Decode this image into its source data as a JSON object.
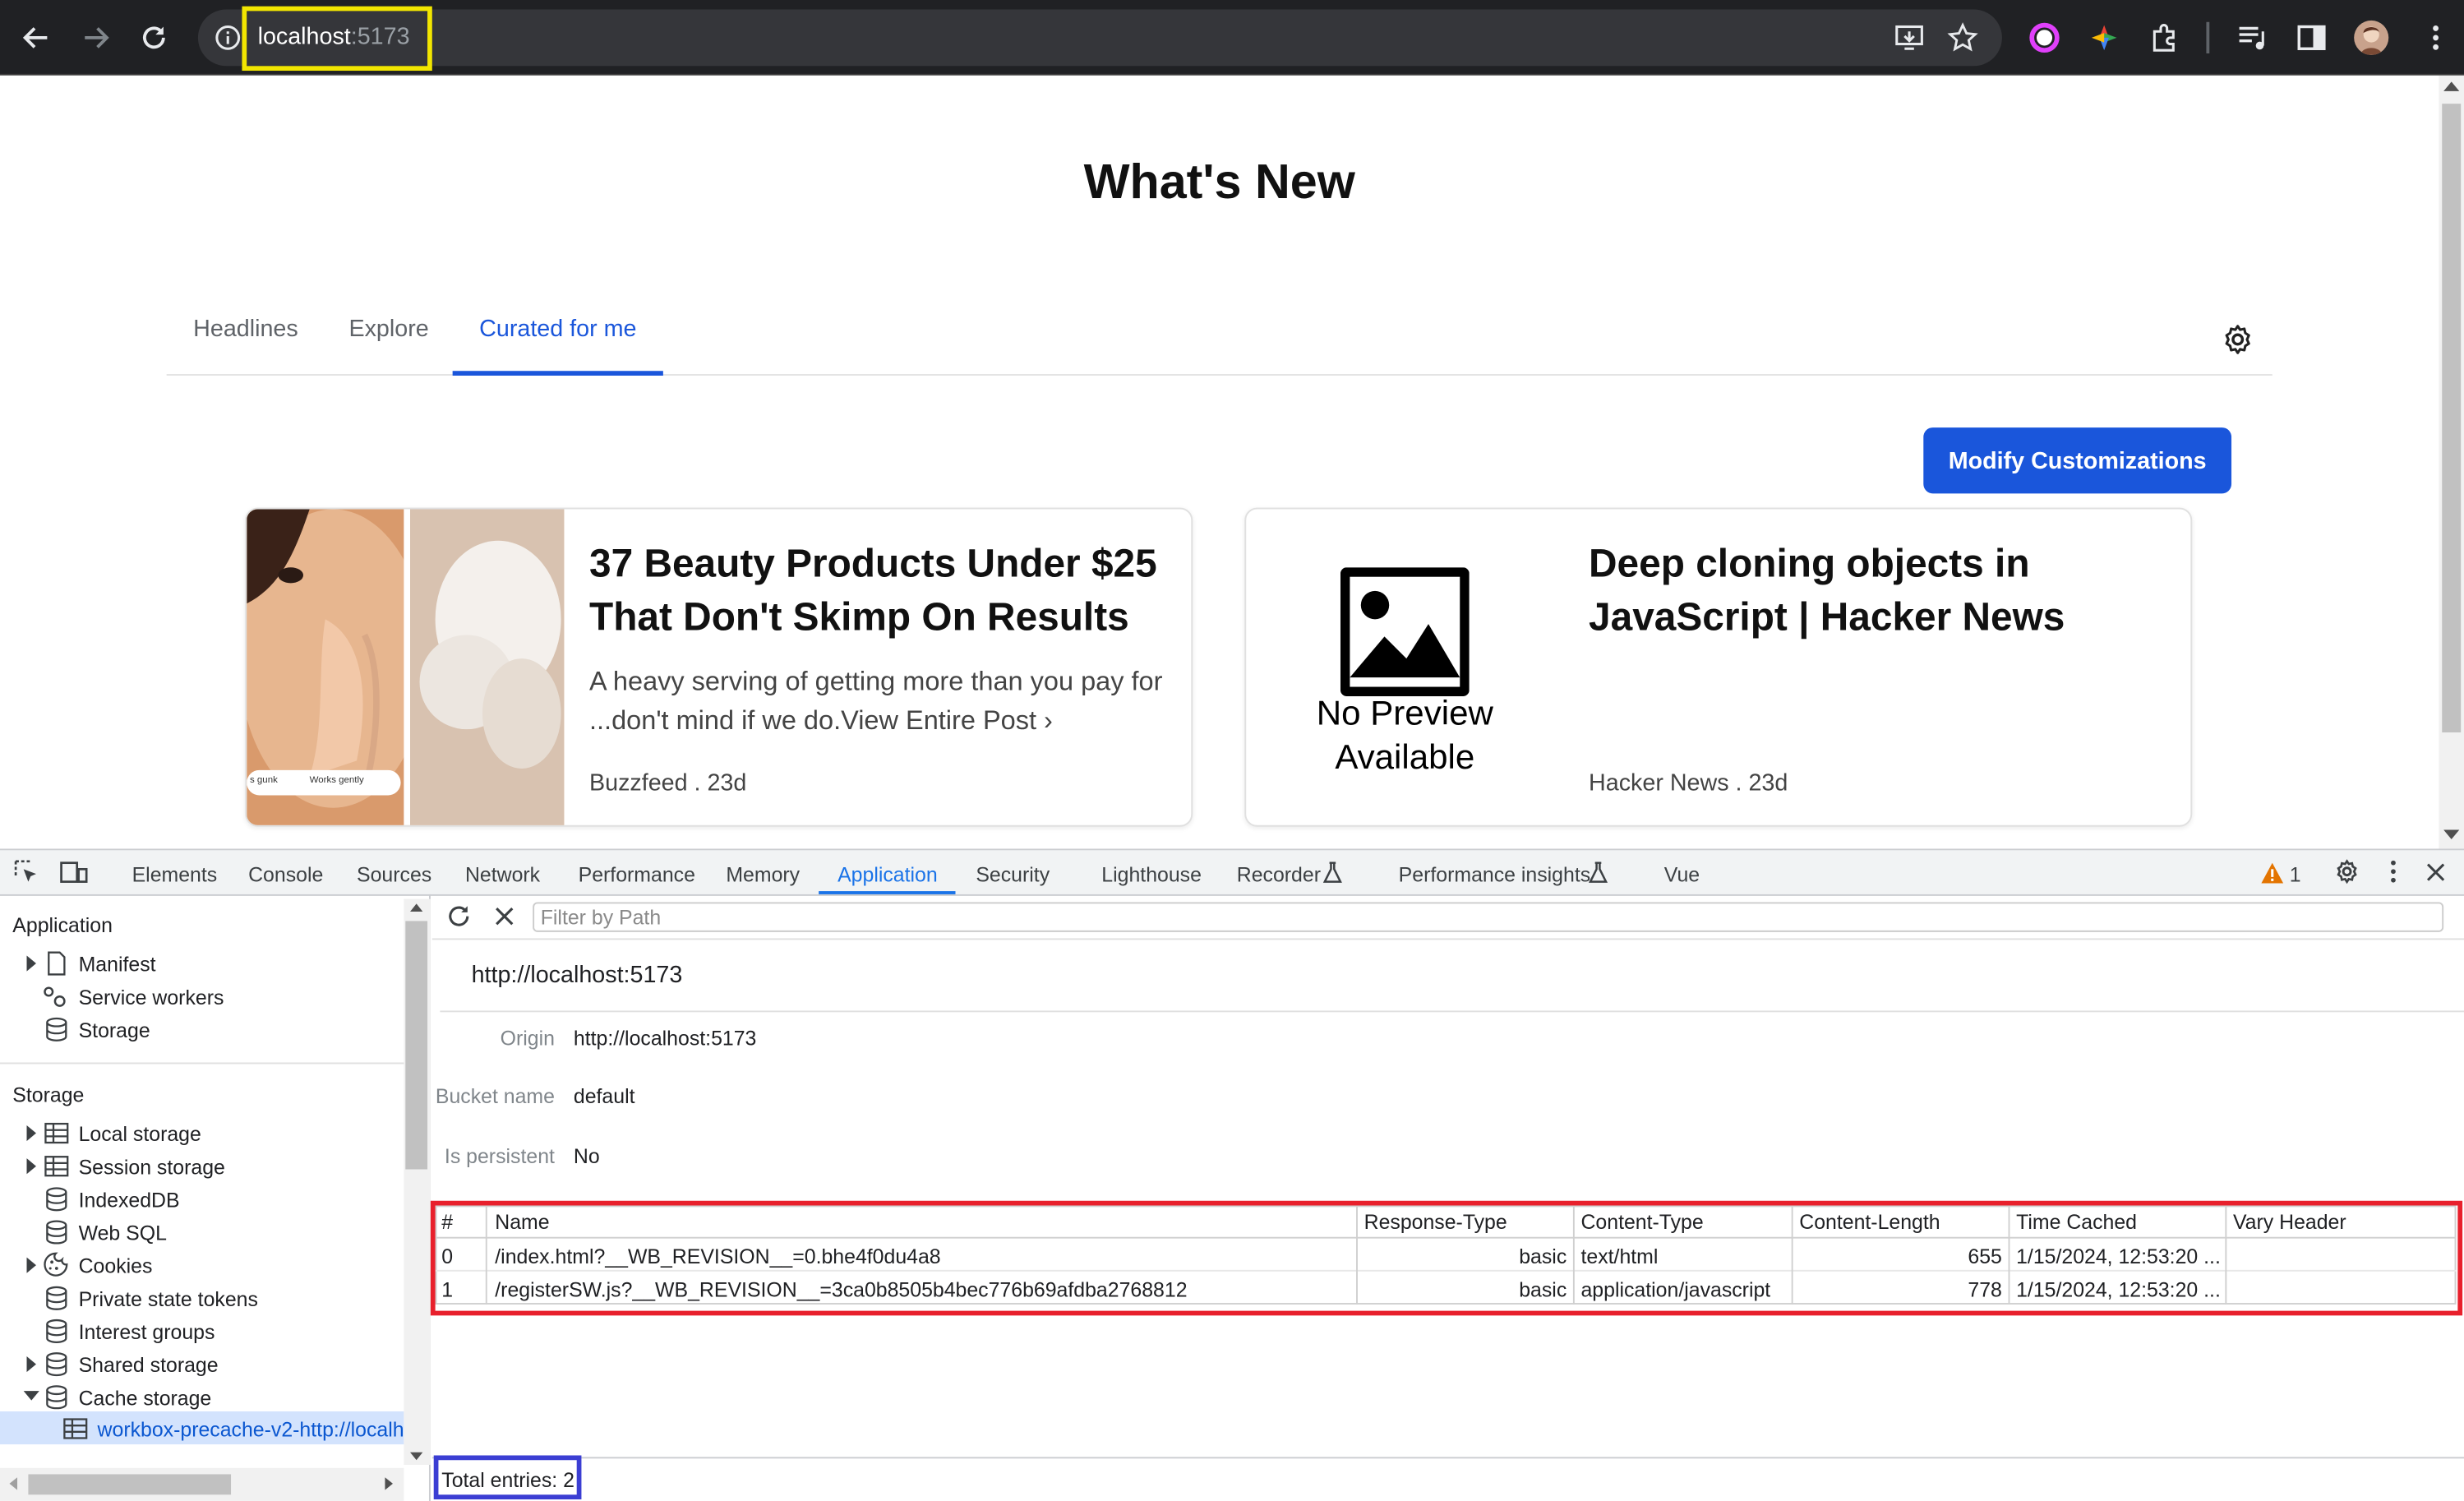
{
  "browser": {
    "url_host": "localhost",
    "url_port": ":5173"
  },
  "page": {
    "title": "What's New",
    "tabs": [
      {
        "label": "Headlines"
      },
      {
        "label": "Explore"
      },
      {
        "label": "Curated for me"
      }
    ],
    "modify_button": "Modify Customizations",
    "cards": [
      {
        "title_line1": "37 Beauty Products Under $25",
        "title_line2": "That Don't Skimp On Results",
        "desc_line1": "A heavy serving of getting more than you pay for",
        "desc_line2": "...don't mind if we do.View Entire Post ›",
        "meta": "Buzzfeed . 23d",
        "image_caption_left": "s gunk",
        "image_caption_right": "Works gently"
      },
      {
        "title_line1": "Deep cloning objects in",
        "title_line2": "JavaScript | Hacker News",
        "meta": "Hacker News . 23d",
        "no_preview_line1": "No Preview",
        "no_preview_line2": "Available"
      }
    ]
  },
  "devtools": {
    "tabs": [
      "Elements",
      "Console",
      "Sources",
      "Network",
      "Performance",
      "Memory",
      "Application",
      "Security",
      "Lighthouse",
      "Recorder",
      "Performance insights",
      "Vue"
    ],
    "warning_count": "1",
    "sidebar": {
      "application_heading": "Application",
      "application_items": [
        "Manifest",
        "Service workers",
        "Storage"
      ],
      "storage_heading": "Storage",
      "storage_items": [
        "Local storage",
        "Session storage",
        "IndexedDB",
        "Web SQL",
        "Cookies",
        "Private state tokens",
        "Interest groups",
        "Shared storage",
        "Cache storage"
      ],
      "cache_entry": "workbox-precache-v2-http://localh"
    },
    "filter_placeholder": "Filter by Path",
    "origin_heading": "http://localhost:5173",
    "details": [
      {
        "key": "Origin",
        "value": "http://localhost:5173"
      },
      {
        "key": "Bucket name",
        "value": "default"
      },
      {
        "key": "Is persistent",
        "value": "No"
      }
    ],
    "table": {
      "headers": [
        "#",
        "Name",
        "Response-Type",
        "Content-Type",
        "Content-Length",
        "Time Cached",
        "Vary Header"
      ],
      "rows": [
        {
          "index": "0",
          "name": "/index.html?__WB_REVISION__=0.bhe4f0du4a8",
          "response_type": "basic",
          "content_type": "text/html",
          "content_length": "655",
          "time_cached": "1/15/2024, 12:53:20 ...",
          "vary": ""
        },
        {
          "index": "1",
          "name": "/registerSW.js?__WB_REVISION__=3ca0b8505b4bec776b69afdba2768812",
          "response_type": "basic",
          "content_type": "application/javascript",
          "content_length": "778",
          "time_cached": "1/15/2024, 12:53:20 ...",
          "vary": ""
        }
      ]
    },
    "total_entries": "Total entries: 2"
  },
  "colors": {
    "accent_blue": "#1a56db",
    "devtools_blue": "#1a73e8",
    "highlight_yellow": "#f2e600",
    "highlight_red": "#e8202c",
    "highlight_indigo": "#3b3ed3"
  }
}
